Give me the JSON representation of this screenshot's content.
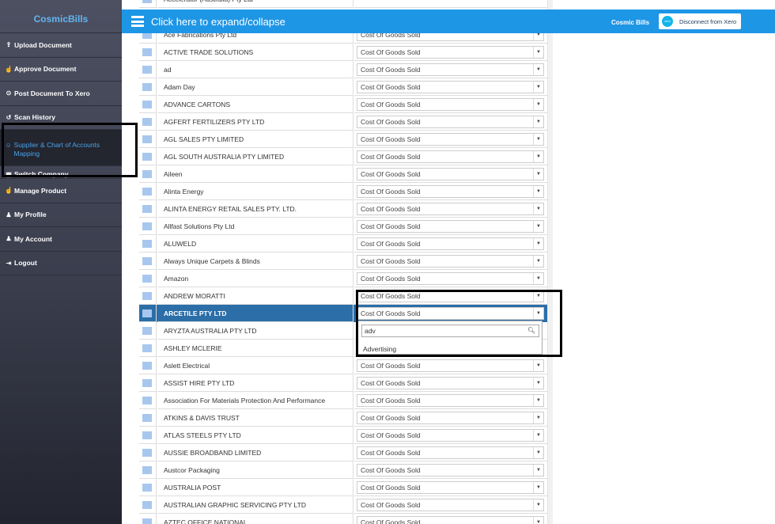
{
  "sidebar": {
    "brand": "CosmicBills",
    "items": [
      {
        "icon": "upload-icon",
        "glyph": "⇪",
        "label": "Upload Document",
        "active": false
      },
      {
        "icon": "thumbs-up-icon",
        "glyph": "☝",
        "label": "Approve Document",
        "active": false
      },
      {
        "icon": "xero-circle-icon",
        "glyph": "⊙",
        "label": "Post Document To Xero",
        "active": false
      },
      {
        "icon": "history-icon",
        "glyph": "↺",
        "label": "Scan History",
        "active": false
      },
      {
        "icon": "user-circle-icon",
        "glyph": "☺",
        "label": "Supplier & Chart of Accounts Mapping",
        "active": true
      },
      {
        "icon": "building-icon",
        "glyph": "▦",
        "label": "Switch Company",
        "active": false,
        "partial": true
      },
      {
        "icon": "thumbs-up-icon",
        "glyph": "☝",
        "label": "Manage Product",
        "active": false
      },
      {
        "icon": "user-icon",
        "glyph": "♟",
        "label": "My Profile",
        "active": false
      },
      {
        "icon": "user-icon",
        "glyph": "♟",
        "label": "My Account",
        "active": false
      },
      {
        "icon": "logout-icon",
        "glyph": "⇥",
        "label": "Logout",
        "active": false
      }
    ]
  },
  "header": {
    "title": "Click here to expand/collapse",
    "brand": "Cosmic Bills",
    "xero_logo_text": "xero",
    "xero_button": "Disconnect from Xero"
  },
  "table": {
    "top_partial": {
      "name": "Accelerator (Australia) Pty Ltd",
      "account": "Cost Of Goods Sold"
    },
    "rows": [
      {
        "name": "Ace Fabrications Pty Ltd",
        "account": "Cost Of Goods Sold"
      },
      {
        "name": "ACTIVE TRADE SOLUTIONS",
        "account": "Cost Of Goods Sold"
      },
      {
        "name": "ad",
        "account": "Cost Of Goods Sold"
      },
      {
        "name": "Adam Day",
        "account": "Cost Of Goods Sold"
      },
      {
        "name": "ADVANCE CARTONS",
        "account": "Cost Of Goods Sold"
      },
      {
        "name": "AGFERT FERTILIZERS PTY LTD",
        "account": "Cost Of Goods Sold"
      },
      {
        "name": "AGL SALES PTY LIMITED",
        "account": "Cost Of Goods Sold"
      },
      {
        "name": "AGL SOUTH AUSTRALIA PTY LIMITED",
        "account": "Cost Of Goods Sold"
      },
      {
        "name": "Aileen",
        "account": "Cost Of Goods Sold"
      },
      {
        "name": "Alinta Energy",
        "account": "Cost Of Goods Sold"
      },
      {
        "name": "ALINTA ENERGY RETAIL SALES PTY. LTD.",
        "account": "Cost Of Goods Sold"
      },
      {
        "name": "Allfast Solutions Pty Ltd",
        "account": "Cost Of Goods Sold"
      },
      {
        "name": "ALUWELD",
        "account": "Cost Of Goods Sold"
      },
      {
        "name": "Always Unique Carpets & Blinds",
        "account": "Cost Of Goods Sold"
      },
      {
        "name": "Amazon",
        "account": "Cost Of Goods Sold"
      },
      {
        "name": "ANDREW MORATTI",
        "account": "Cost Of Goods Sold"
      },
      {
        "name": "ARCETILE PTY LTD",
        "account": "Cost Of Goods Sold",
        "selected": true
      },
      {
        "name": "ARYZTA AUSTRALIA PTY LTD",
        "account": ""
      },
      {
        "name": "ASHLEY MCLERIE",
        "account": ""
      },
      {
        "name": "Aslett Electrical",
        "account": "Cost Of Goods Sold"
      },
      {
        "name": "ASSIST HIRE PTY LTD",
        "account": "Cost Of Goods Sold"
      },
      {
        "name": "Association For Materials Protection And Performance",
        "account": "Cost Of Goods Sold"
      },
      {
        "name": "ATKINS & DAVIS TRUST",
        "account": "Cost Of Goods Sold"
      },
      {
        "name": "ATLAS STEELS PTY LTD",
        "account": "Cost Of Goods Sold"
      },
      {
        "name": "AUSSIE BROADBAND LIMITED",
        "account": "Cost Of Goods Sold"
      },
      {
        "name": "Austcor Packaging",
        "account": "Cost Of Goods Sold"
      },
      {
        "name": "AUSTRALIA POST",
        "account": "Cost Of Goods Sold"
      },
      {
        "name": "AUSTRALIAN GRAPHIC SERVICING PTY LTD",
        "account": "Cost Of Goods Sold"
      },
      {
        "name": "AZTEC OFFICE NATIONAL",
        "account": "Cost Of Goods Sold"
      }
    ]
  },
  "dropdown": {
    "search_value": "adv",
    "options": [
      "Advertising"
    ]
  },
  "colors": {
    "sidebar_bg": "#3a3d4c",
    "header_bg": "#1e96e6",
    "selected_row": "#2b6ea8",
    "active_nav_text": "#4aa3e8"
  }
}
